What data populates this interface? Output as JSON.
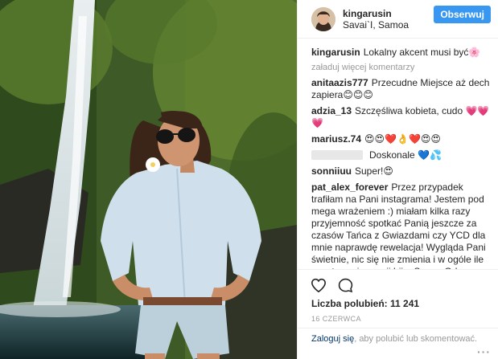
{
  "post": {
    "username": "kingarusin",
    "location": "Savai`I, Samoa",
    "follow_label": "Obserwuj",
    "caption_author": "kingarusin",
    "caption_text": "Lokalny akcent musi być🌸"
  },
  "comments_section": {
    "load_more_label": "załaduj więcej komentarzy",
    "items": [
      {
        "author": "anitaazis777",
        "text": "Przecudne Miejsce aż dech zapiera😊😊😊"
      },
      {
        "author": "adzia_13",
        "text": "Szczęśliwa kobieta, cudo 💗💗💗"
      },
      {
        "author": "mariusz.74",
        "text": "😍😍❤️👌❤️😍😍"
      },
      {
        "author": "",
        "text": "Doskonale 💙💦"
      },
      {
        "author": "sonniiuu",
        "text": "Super!😍"
      },
      {
        "author": "pat_alex_forever",
        "text": "Przez przypadek trafiłam na Pani instagrama! Jestem pod mega wrażeniem :) miałam kilka razy przyjemność spotkać Panią jeszcze za czasów Tańca z Gwiazdami czy YCD dla mnie naprawdę rewelacja! Wygląda Pani świetnie, nic się nie zmienia i w ogóle ile pozytywnej energii bije. Super. Od najmłodszych lat bardzo Panią lubiłam. A"
      }
    ]
  },
  "stats": {
    "likes_label": "Liczba polubień: 11 241",
    "date": "16 CZERWCA"
  },
  "footer": {
    "login_link": "Zaloguj się",
    "login_text": ", aby polubić lub skomentować.",
    "more_label": "···"
  },
  "icons": {
    "like": "heart-icon",
    "comment": "comment-icon",
    "more": "more-options-icon"
  },
  "colors": {
    "accent": "#3897f0",
    "link": "#003569",
    "muted": "#999999"
  }
}
